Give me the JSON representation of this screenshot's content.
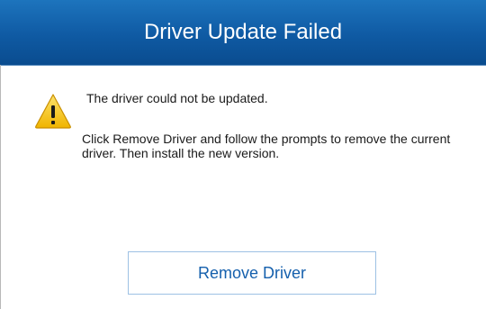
{
  "dialog": {
    "title": "Driver Update Failed",
    "icon": "warning-icon",
    "message_primary": "The driver could not be updated.",
    "message_secondary": "Click Remove Driver and follow the prompts to remove the current driver. Then install the new version.",
    "remove_button_label": "Remove Driver"
  },
  "colors": {
    "title_bar": "#0f5aa3",
    "title_text": "#ffffff",
    "button_text": "#1560ad",
    "button_border": "#9ec1e4",
    "warning_fill": "#f5c518"
  }
}
